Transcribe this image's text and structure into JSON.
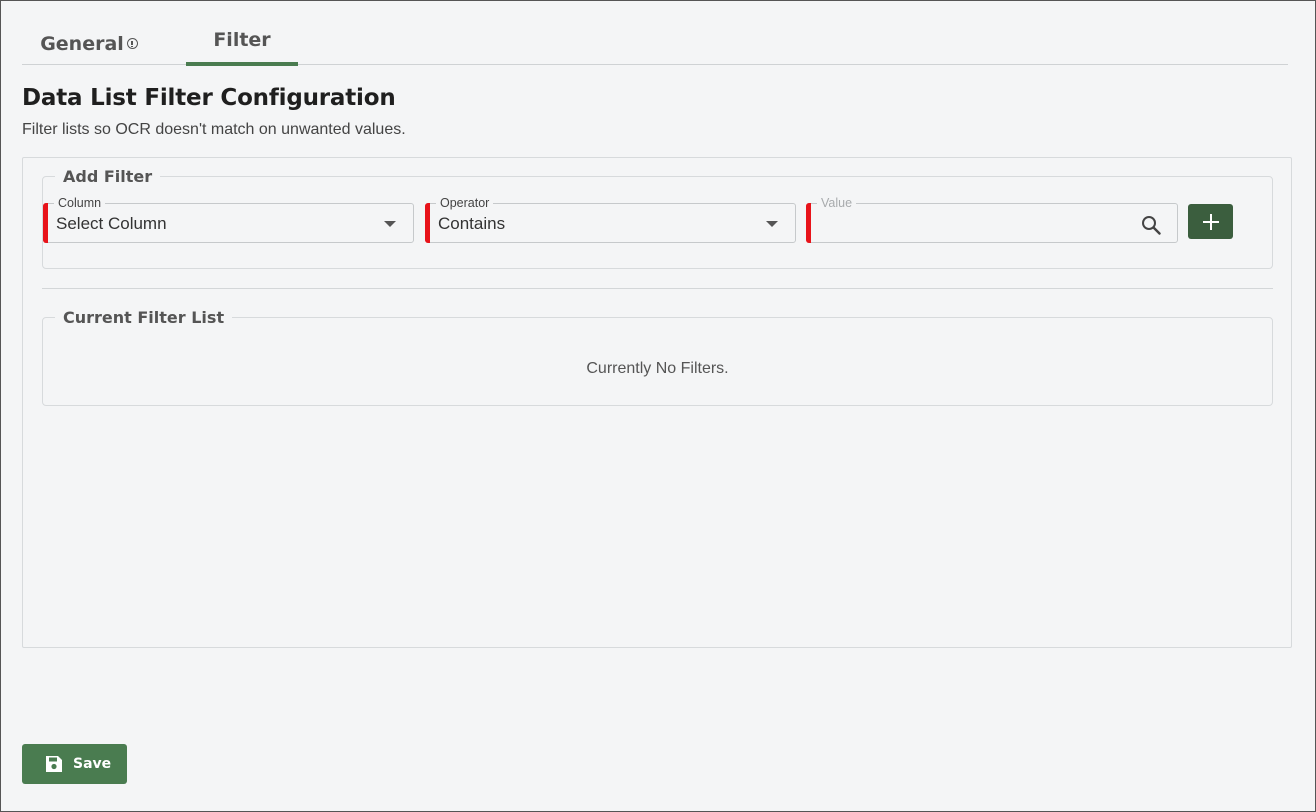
{
  "tabs": [
    {
      "label": "General",
      "has_info_icon": true,
      "active": false
    },
    {
      "label": "Filter",
      "active": true
    }
  ],
  "page": {
    "title": "Data List Filter Configuration",
    "subtitle": "Filter lists so OCR doesn't match on unwanted values."
  },
  "add_filter": {
    "legend": "Add Filter",
    "column": {
      "label": "Column",
      "value": "Select Column",
      "required": true
    },
    "operator": {
      "label": "Operator",
      "value": "Contains",
      "required": true
    },
    "value": {
      "label": "Value",
      "value": "",
      "required": true,
      "icon": "search-icon"
    },
    "add_button_icon": "plus-icon"
  },
  "current_filter_list": {
    "legend": "Current Filter List",
    "empty_message": "Currently No Filters."
  },
  "actions": {
    "save_label": "Save",
    "save_icon": "floppy-disk-icon"
  },
  "colors": {
    "accent": "#4a7c50",
    "add_button": "#3b5e3e",
    "required": "#e8131a",
    "background": "#f4f5f6"
  }
}
